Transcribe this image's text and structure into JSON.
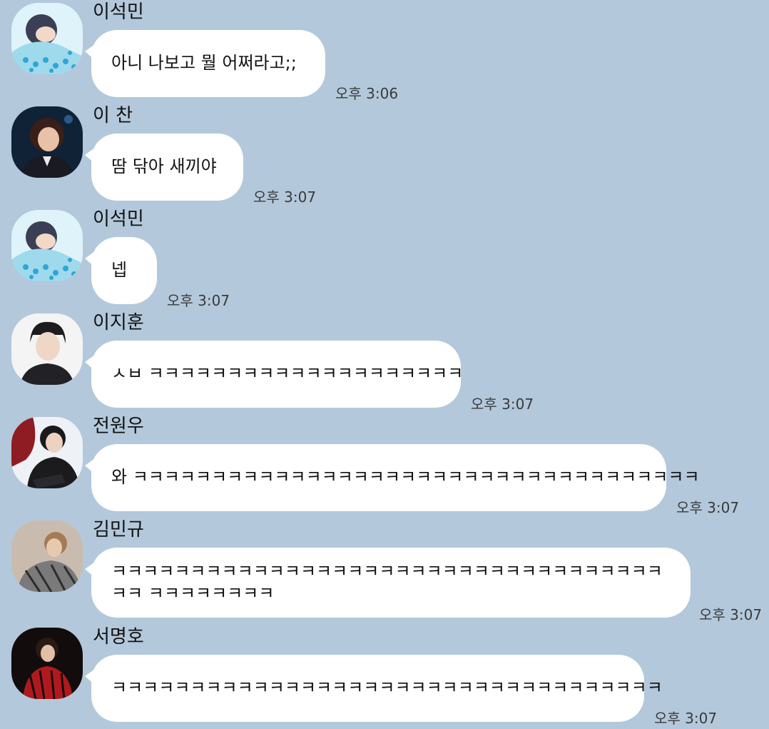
{
  "messages": [
    {
      "sender": "이석민",
      "text": "아니 나보고 뭘 어쩌라고;;",
      "time": "오후 3:06"
    },
    {
      "sender": "이 찬",
      "text": "땀 닦아 새끼야",
      "time": "오후 3:07"
    },
    {
      "sender": "이석민",
      "text": "넵",
      "time": "오후 3:07"
    },
    {
      "sender": "이지훈",
      "text": "ㅅㅂ ㅋㅋㅋㅋㅋㅋㅋㅋㅋㅋㅋㅋㅋㅋㅋㅋㅋㅋㅋㅋ",
      "time": "오후 3:07"
    },
    {
      "sender": "전원우",
      "text": "와 ㅋㅋㅋㅋㅋㅋㅋㅋㅋㅋㅋㅋㅋㅋㅋㅋㅋㅋㅋㅋㅋㅋㅋㅋㅋㅋㅋㅋㅋㅋㅋㅋㅋㅋㅋㅋ",
      "time": "오후 3:07"
    },
    {
      "sender": "김민규",
      "text": "ㅋㅋㅋㅋㅋㅋㅋㅋㅋㅋㅋㅋㅋㅋㅋㅋㅋㅋㅋㅋㅋㅋㅋㅋㅋㅋㅋㅋㅋㅋㅋㅋㅋㅋㅋㅋㅋ ㅋㅋㅋㅋㅋㅋㅋㅋ",
      "time": "오후 3:07"
    },
    {
      "sender": "서명호",
      "text": "ㅋㅋㅋㅋㅋㅋㅋㅋㅋㅋㅋㅋㅋㅋㅋㅋㅋㅋㅋㅋㅋㅋㅋㅋㅋㅋㅋㅋㅋㅋㅋㅋㅋㅋㅋ",
      "time": "오후 3:07"
    }
  ],
  "colors": {
    "background": "#b3c8db",
    "bubble": "#ffffff"
  },
  "avatar_icons": [
    "profile-photo-icon"
  ]
}
